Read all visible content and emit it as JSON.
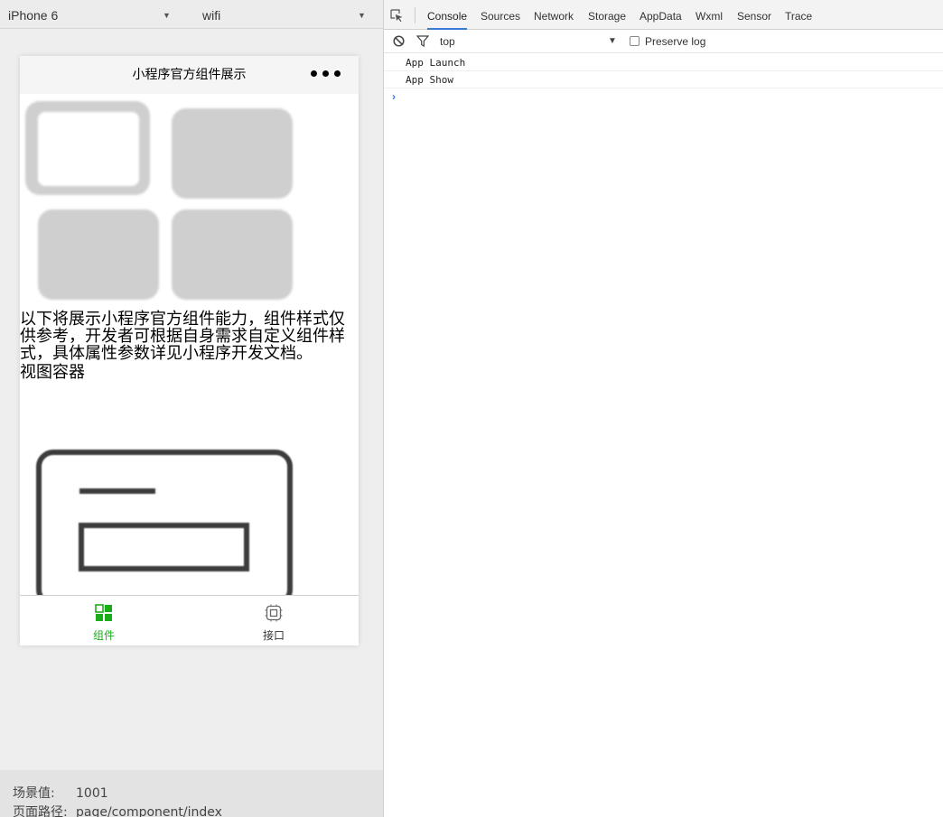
{
  "simulator": {
    "device": "iPhone 6",
    "network": "wifi",
    "nav_title": "小程序官方组件展示",
    "intro_text": "以下将展示小程序官方组件能力，组件样式仅供参考，开发者可根据自身需求自定义组件样式，具体属性参数详见小程序开发文档。",
    "section_label": "视图容器",
    "tabbar": {
      "items": [
        {
          "label": "组件",
          "icon": "grid-icon",
          "active": true
        },
        {
          "label": "接口",
          "icon": "chip-icon",
          "active": false
        }
      ],
      "active_color": "#1AAD19",
      "inactive_color": "#333333"
    },
    "status": {
      "scene_label": "场景值:",
      "scene_value": "1001",
      "path_label": "页面路径:",
      "path_value": "page/component/index"
    }
  },
  "devtools": {
    "tabs": [
      "Console",
      "Sources",
      "Network",
      "Storage",
      "AppData",
      "Wxml",
      "Sensor",
      "Trace"
    ],
    "active_tab": "Console",
    "context": "top",
    "preserve_log_label": "Preserve log",
    "preserve_log_checked": false,
    "logs": [
      "App Launch",
      "App Show"
    ],
    "prompt": "›",
    "accent_color": "#3879d9"
  }
}
